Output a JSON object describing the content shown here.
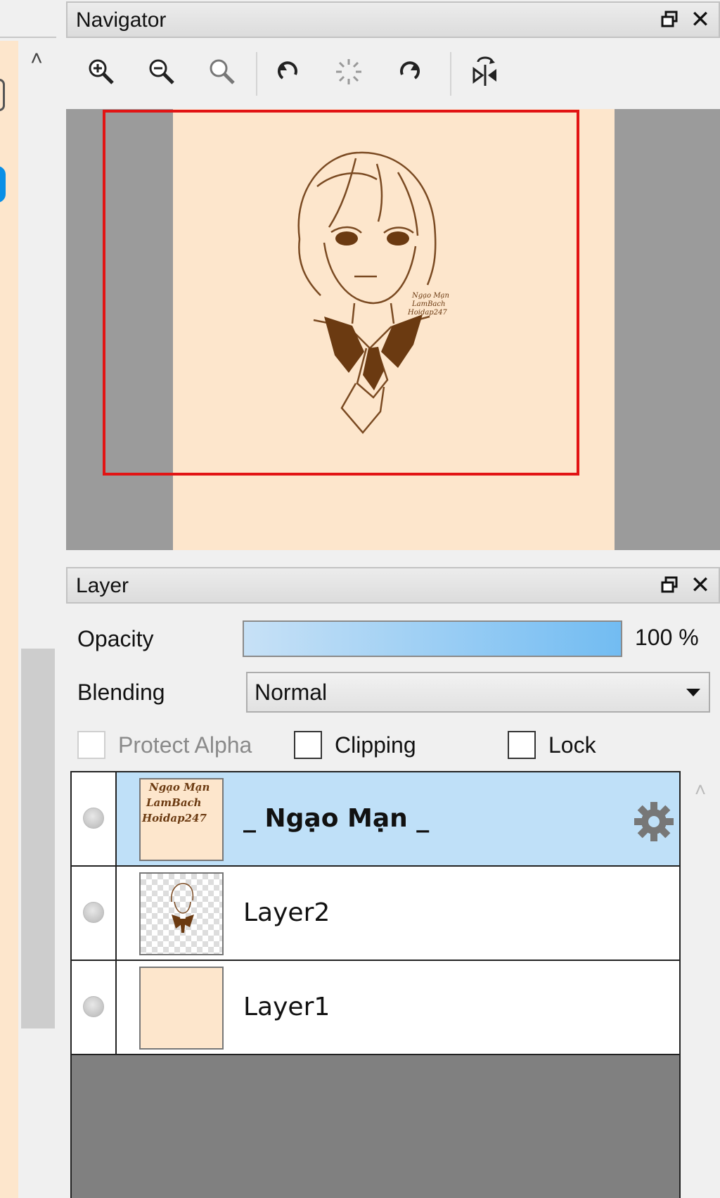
{
  "navigator": {
    "title": "Navigator",
    "toolbar": [
      "zoom-in-icon",
      "zoom-out-icon",
      "zoom-reset-icon",
      "rotate-left-icon",
      "rotate-reset-icon",
      "rotate-right-icon",
      "flip-horizontal-icon"
    ]
  },
  "layer_panel": {
    "title": "Layer",
    "opacity_label": "Opacity",
    "opacity_value": "100 %",
    "opacity_fraction": 1.0,
    "blending_label": "Blending",
    "blending_value": "Normal",
    "protect_alpha_label": "Protect Alpha",
    "clipping_label": "Clipping",
    "lock_label": "Lock",
    "layers": [
      {
        "name": "_ Ngạo Mạn _",
        "selected": true,
        "thumb_text": [
          "Ngạo Mạn",
          "LamBach",
          "Hoidap247"
        ]
      },
      {
        "name": "Layer2",
        "selected": false
      },
      {
        "name": "Layer1",
        "selected": false
      }
    ]
  },
  "canvas_signature": [
    "Ngạo Mạn",
    "LamBach",
    "Hoidap247"
  ],
  "colors": {
    "canvas_bg": "#fde6cc",
    "ink": "#6b3a11",
    "viewport_rect": "#e21414",
    "selected_row": "#bfe0f8",
    "accent_blue": "#0a8fe6"
  }
}
